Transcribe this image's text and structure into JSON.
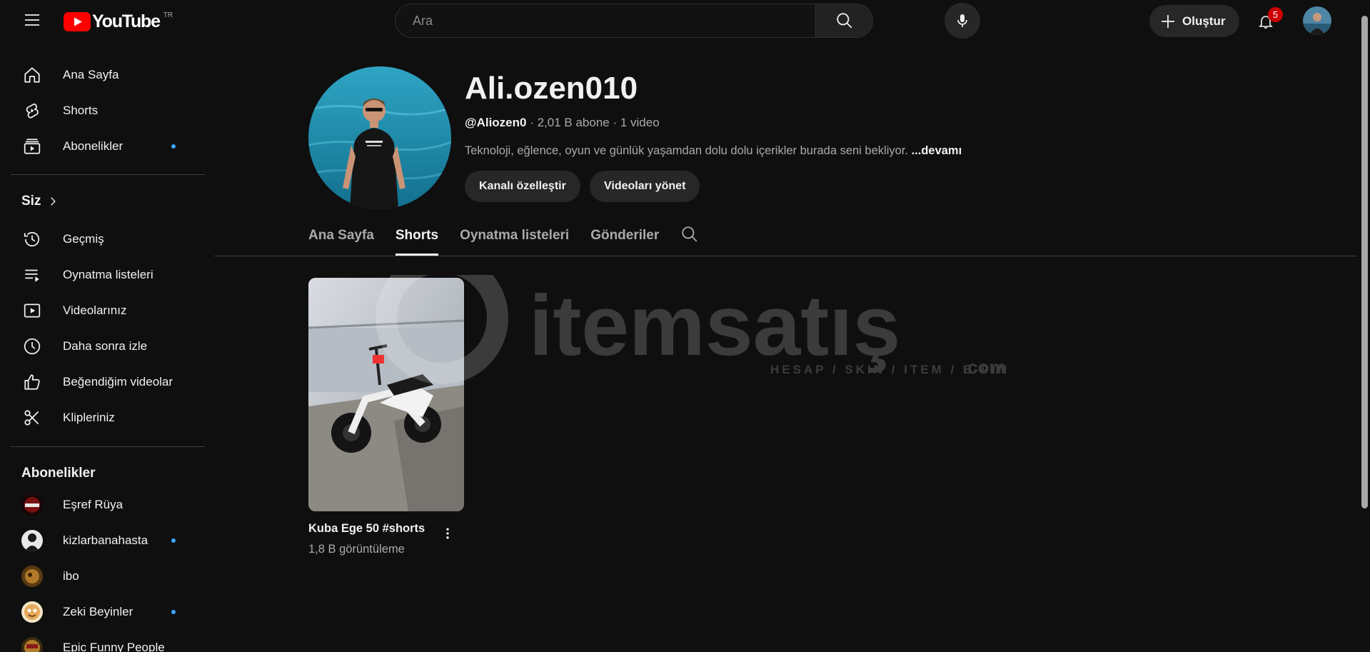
{
  "topbar": {
    "logo_text": "YouTube",
    "logo_country": "TR",
    "search_placeholder": "Ara",
    "create_label": "Oluştur",
    "notification_count": "5"
  },
  "sidebar": {
    "main": [
      {
        "label": "Ana Sayfa",
        "icon": "home-icon"
      },
      {
        "label": "Shorts",
        "icon": "shorts-icon"
      },
      {
        "label": "Abonelikler",
        "icon": "subscriptions-icon",
        "dot": true
      }
    ],
    "you_title": "Siz",
    "you": [
      {
        "label": "Geçmiş",
        "icon": "history-icon"
      },
      {
        "label": "Oynatma listeleri",
        "icon": "playlists-icon"
      },
      {
        "label": "Videolarınız",
        "icon": "your-videos-icon"
      },
      {
        "label": "Daha sonra izle",
        "icon": "watch-later-icon"
      },
      {
        "label": "Beğendiğim videolar",
        "icon": "liked-videos-icon"
      },
      {
        "label": "Klipleriniz",
        "icon": "clips-icon"
      }
    ],
    "subscriptions_title": "Abonelikler",
    "subscriptions": [
      {
        "label": "Eşref Rüya",
        "dot": false,
        "color": "#7a1010"
      },
      {
        "label": "kizlarbanahasta",
        "dot": true,
        "color": "#d9d9d9"
      },
      {
        "label": "ibo",
        "dot": false,
        "color": "#8a5a20"
      },
      {
        "label": "Zeki Beyinler",
        "dot": true,
        "color": "#e6a95a"
      },
      {
        "label": "Epic Funny People",
        "dot": false,
        "color": "#b07a2a"
      }
    ]
  },
  "channel": {
    "name": "Ali.ozen010",
    "handle": "@Aliozen0",
    "meta_rest": " · 2,01 B abone · 1 video",
    "description": "Teknoloji, eğlence, oyun ve günlük yaşamdan dolu dolu içerikler burada seni bekliyor.",
    "more_label": "...devamı",
    "customize_label": "Kanalı özelleştir",
    "manage_label": "Videoları yönet"
  },
  "tabs": [
    {
      "label": "Ana Sayfa",
      "active": false
    },
    {
      "label": "Shorts",
      "active": true
    },
    {
      "label": "Oynatma listeleri",
      "active": false
    },
    {
      "label": "Gönderiler",
      "active": false
    }
  ],
  "shorts": [
    {
      "title": "Kuba Ege 50 #shorts",
      "views": "1,8 B görüntüleme"
    }
  ],
  "watermark": {
    "brand": "itemsatış",
    "tagline": "HESAP / SKIN / ITEM / E-PIN",
    "suffix": ".com"
  },
  "colors": {
    "background": "#0f0f0f",
    "accent_red": "#ff0000",
    "badge_red": "#cc0000",
    "dot_blue": "#3ea6ff",
    "chip_bg": "#272727"
  }
}
